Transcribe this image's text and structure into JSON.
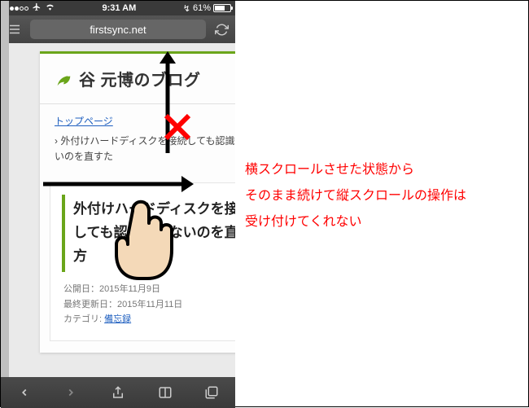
{
  "status": {
    "time": "9:31 AM",
    "battery_pct": "61%",
    "recharge": "↯"
  },
  "nav": {
    "url": "firstsync.net"
  },
  "site": {
    "title": "谷 元博のブログ"
  },
  "breadcrumb": {
    "top": "トップページ",
    "current": "外付けハードディスクを接続しても認識されないのを直すた"
  },
  "article": {
    "title": "外付けハードディスクを接続しても認識されないのを直す方",
    "published_label": "公開日：",
    "published": "2015年11月9日",
    "updated_label": "最終更新日：",
    "updated": "2015年11月11日",
    "category_label": "カテゴリ: ",
    "category": "備忘録"
  },
  "annotation": {
    "line1": "横スクロールさせた状態から",
    "line2": "そのまま続けて縦スクロールの操作は",
    "line3": "受け付けてくれない"
  }
}
